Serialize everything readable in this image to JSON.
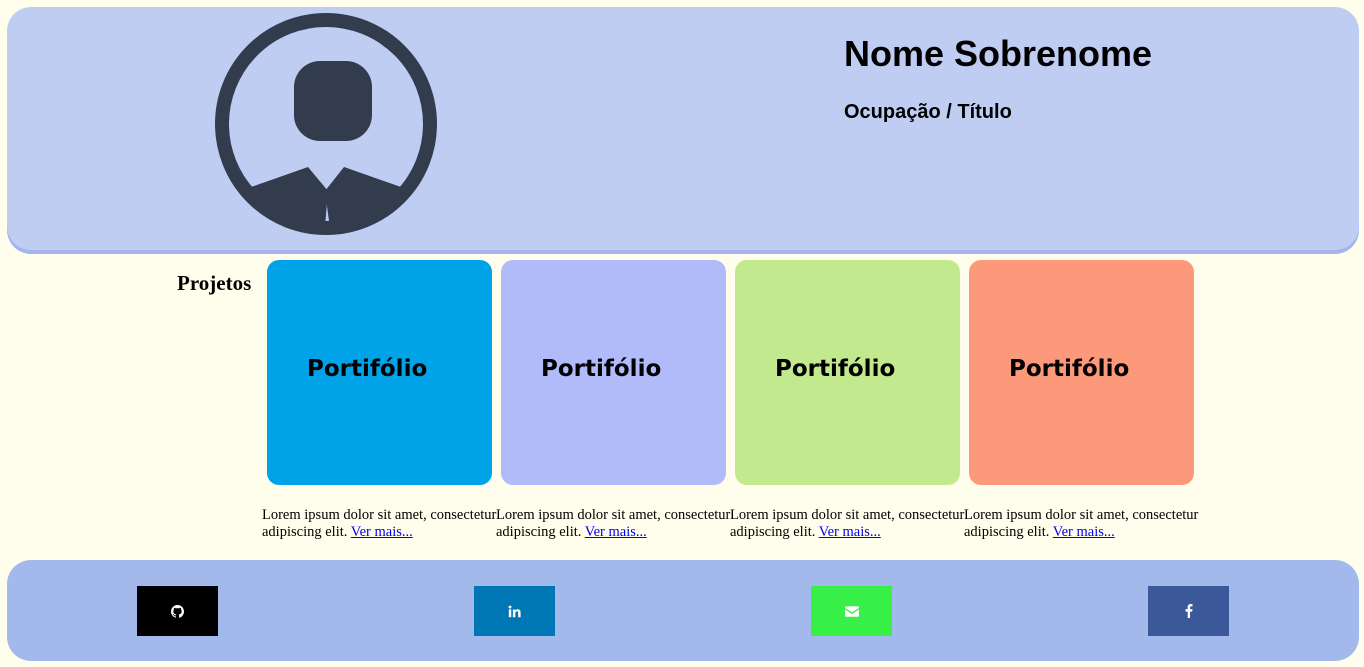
{
  "header": {
    "name": "Nome Sobrenome",
    "role": "Ocupação / Título",
    "avatar_icon": "user-avatar-icon"
  },
  "projects": {
    "title": "Projetos",
    "cards": [
      {
        "label": "Portifólio",
        "color": "#00a3e8",
        "desc": "Lorem ipsum dolor sit amet, consectetur adipiscing elit.",
        "link": "Ver mais..."
      },
      {
        "label": "Portifólio",
        "color": "#b1bbfa",
        "desc": "Lorem ipsum dolor sit amet, consectetur adipiscing elit.",
        "link": "Ver mais..."
      },
      {
        "label": "Portifólio",
        "color": "#c2e98e",
        "desc": "Lorem ipsum dolor sit amet, consectetur adipiscing elit.",
        "link": "Ver mais..."
      },
      {
        "label": "Portifólio",
        "color": "#fb997a",
        "desc": "Lorem ipsum dolor sit amet, consectetur adipiscing elit.",
        "link": "Ver mais..."
      }
    ]
  },
  "footer": {
    "links": [
      {
        "icon": "github-icon",
        "color": "#000000"
      },
      {
        "icon": "linkedin-icon",
        "color": "#0077b5"
      },
      {
        "icon": "envelope-icon",
        "color": "#37ef47"
      },
      {
        "icon": "facebook-icon",
        "color": "#3b5998"
      }
    ]
  },
  "colors": {
    "page_bg": "#fffeec",
    "header_bg": "#bfcdf3",
    "footer_bg": "#a4b9eb",
    "avatar": "#323c4c"
  }
}
